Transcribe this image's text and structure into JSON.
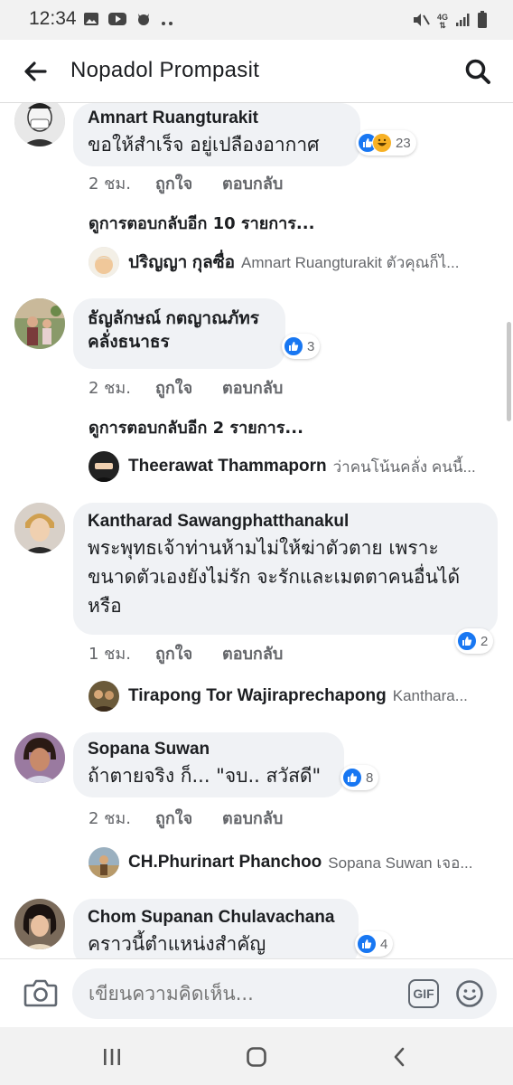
{
  "status_bar": {
    "time": "12:34",
    "left_icons": [
      "image-icon",
      "youtube-icon",
      "cat-icon",
      "more-dots-icon"
    ],
    "right_icons": [
      "mute-icon",
      "4g-signal-icon",
      "signal-bars-icon",
      "battery-icon"
    ],
    "network_label": "4G"
  },
  "header": {
    "title": "Nopadol Prompasit",
    "back_icon": "arrow-left-icon",
    "search_icon": "search-icon"
  },
  "comments": [
    {
      "name": "Amnart Ruangturakit",
      "text_lines": [
        "ขอให้สำเร็จ  อยู่เปลืองอากาศ"
      ],
      "reaction_icons": [
        "like",
        "haha"
      ],
      "reaction_count": "23",
      "time": "2 ชม.",
      "like_label": "ถูกใจ",
      "reply_label": "ตอบกลับ",
      "more_replies": "ดูการตอบกลับอีก 10 รายการ...",
      "reply_preview": {
        "name": "ปริญญา กุลซื่อ",
        "text": "Amnart Ruangturakit ตัวคุณก็ไ..."
      }
    },
    {
      "name": "ธัญลักษณ์ กตญาณภัทร",
      "name_line2": "คลั่งธนาธร",
      "text_lines": [],
      "reaction_icons": [
        "like"
      ],
      "reaction_count": "3",
      "time": "2 ชม.",
      "like_label": "ถูกใจ",
      "reply_label": "ตอบกลับ",
      "more_replies": "ดูการตอบกลับอีก 2 รายการ...",
      "reply_preview": {
        "name": "Theerawat Thammaporn",
        "text": "ว่าคนโน้นคลั่ง คนนี้..."
      }
    },
    {
      "name": "Kantharad Sawangphatthanakul",
      "text_lines": [
        "พระพุทธเจ้าท่านห้ามไม่ให้ฆ่าตัวตาย เพราะ",
        "ขนาดตัวเองยังไม่รัก จะรักและเมตตาคนอื่นได้",
        "หรือ"
      ],
      "reaction_icons": [
        "like"
      ],
      "reaction_count": "2",
      "time": "1 ชม.",
      "like_label": "ถูกใจ",
      "reply_label": "ตอบกลับ",
      "reply_preview": {
        "name": "Tirapong Tor Wajiraprechapong",
        "text": "Kanthara..."
      }
    },
    {
      "name": "Sopana Suwan",
      "text_lines": [
        "ถ้าตายจริง ก็... \"จบ.. สวัสดี\""
      ],
      "reaction_icons": [
        "like"
      ],
      "reaction_count": "8",
      "time": "2 ชม.",
      "like_label": "ถูกใจ",
      "reply_label": "ตอบกลับ",
      "reply_preview": {
        "name": "CH.Phurinart Phanchoo",
        "text": "Sopana Suwan เจอ..."
      }
    },
    {
      "name": "Chom Supanan Chulavachana",
      "text_lines": [
        "คราวนี้ตำแหน่งสำคัญ"
      ],
      "reaction_icons": [
        "like"
      ],
      "reaction_count": "4"
    }
  ],
  "composer": {
    "placeholder": "เขียนความคิดเห็น...",
    "gif_label": "GIF",
    "camera_icon": "camera-icon",
    "emoji_icon": "smiley-icon"
  },
  "nav_bar": {
    "icons": [
      "recent-apps-icon",
      "home-icon",
      "back-chevron-icon"
    ]
  },
  "colors": {
    "accent": "#1877f2",
    "bubble_bg": "#f0f2f5",
    "secondary_text": "#65676b",
    "haha": "#f7b125"
  }
}
